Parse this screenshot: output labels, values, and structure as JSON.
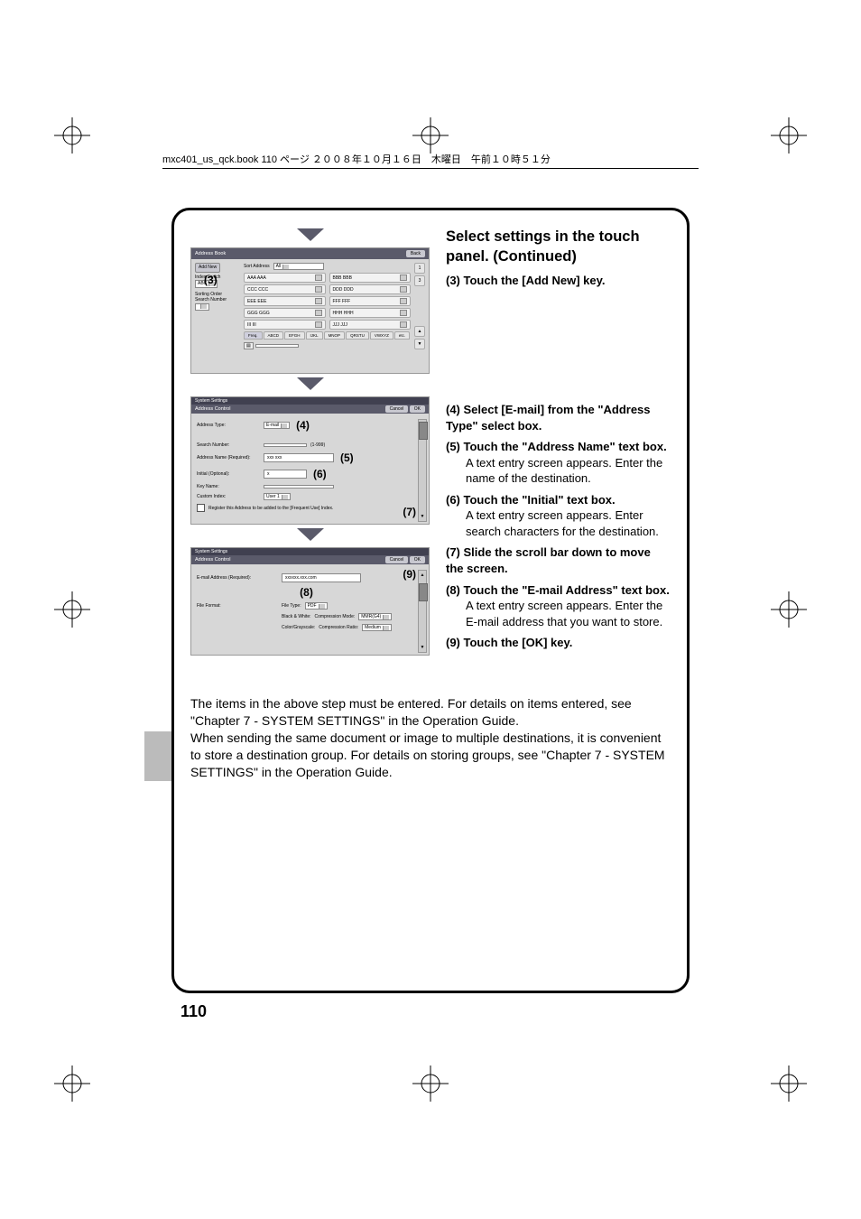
{
  "header_line": "mxc401_us_qck.book  110 ページ  ２００８年１０月１６日　木曜日　午前１０時５１分",
  "page_number": "110",
  "right": {
    "heading": "Select settings in the touch panel. (Continued)",
    "steps": [
      {
        "n": "(3)",
        "t": "Touch the [Add New] key."
      },
      {
        "n": "(4)",
        "t": "Select [E-mail] from the \"Address Type\" select box."
      },
      {
        "n": "(5)",
        "t": "Touch the \"Address Name\" text box.",
        "d": "A text entry screen appears. Enter the name of the destination."
      },
      {
        "n": "(6)",
        "t": "Touch the \"Initial\" text box.",
        "d": "A text entry screen appears. Enter search characters for the destination."
      },
      {
        "n": "(7)",
        "t": "Slide the scroll bar down to move the screen."
      },
      {
        "n": "(8)",
        "t": "Touch the \"E-mail Address\" text box.",
        "d": "A text entry screen appears. Enter the E-mail address that you want to store."
      },
      {
        "n": "(9)",
        "t": "Touch the [OK] key."
      }
    ]
  },
  "footer": "The items in the above step must be entered. For details on items entered, see \"Chapter 7 - SYSTEM SETTINGS\" in the Operation Guide.\nWhen sending the same document or image to multiple destinations, it is convenient to store a destination group. For details on storing groups, see \"Chapter 7 - SYSTEM SETTINGS\" in the Operation Guide.",
  "panel1": {
    "title": "Address Book",
    "back": "Back",
    "add_new": "Add New",
    "sort_address": "Sort Address",
    "sort_value": "All",
    "index_switch": "Index Switch",
    "index_value": "ABC",
    "sorting_order": "Sorting Order",
    "search_number": "Search Number",
    "page_counter_top": "1",
    "page_counter_bottom": "3",
    "entries": [
      "AAA AAA",
      "BBB BBB",
      "CCC CCC",
      "DDD DDD",
      "EEE EEE",
      "FFF FFF",
      "GGG GGG",
      "HHH HHH",
      "III III",
      "JJJ JJJ"
    ],
    "tabs": [
      "Freq.",
      "ABCD",
      "EFGH",
      "IJKL",
      "MNOP",
      "QRSTU",
      "VWXYZ",
      "etc."
    ],
    "callout3": "(3)"
  },
  "panel2": {
    "sys": "System Settings",
    "title": "Address Control",
    "cancel": "Cancel",
    "ok": "OK",
    "address_type_lbl": "Address Type:",
    "address_type_val": "E-mail",
    "search_number_lbl": "Search Number:",
    "search_number_hint": "(1-999)",
    "address_name_lbl": "Address Name (Required):",
    "address_name_val": "xxx xxx",
    "initial_lbl": "Initial (Optional):",
    "initial_val": "x",
    "key_name_lbl": "Key Name:",
    "custom_index_lbl": "Custom Index:",
    "custom_index_val": "User 1",
    "register_lbl": "Register this Address to be added to the [Frequent Use] Index.",
    "callout4": "(4)",
    "callout5": "(5)",
    "callout6": "(6)",
    "callout7": "(7)"
  },
  "panel3": {
    "sys": "System Settings",
    "title": "Address Control",
    "cancel": "Cancel",
    "ok": "OK",
    "email_lbl": "E-mail Address (Required):",
    "email_val": "xxxxxx.xxx.com",
    "file_format_lbl": "File Format:",
    "file_type_lbl": "File Type:",
    "file_type_val": "PDF",
    "bw_lbl": "Black & White:",
    "comp_mode_lbl": "Compression Mode:",
    "comp_mode_val": "MMR(G4)",
    "cg_lbl": "Color/Grayscale:",
    "comp_ratio_lbl": "Compression Ratio:",
    "comp_ratio_val": "Medium",
    "callout8": "(8)",
    "callout9": "(9)"
  }
}
